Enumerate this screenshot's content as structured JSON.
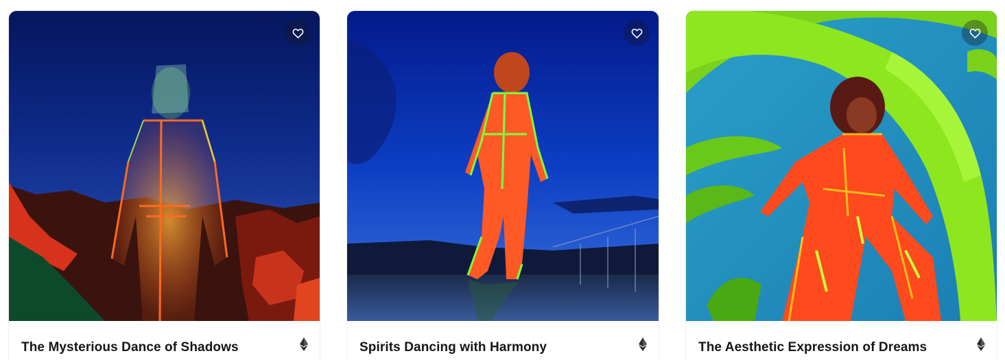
{
  "colors": {
    "text": "#161616",
    "favorite_bg": "rgba(20,24,40,0.35)",
    "card_border": "#ececec"
  },
  "cards": [
    {
      "title": "The Mysterious Dance of Shadows",
      "favorite_icon": "heart-outline-icon",
      "chain_icon": "ethereum-icon"
    },
    {
      "title": "Spirits Dancing with Harmony",
      "favorite_icon": "heart-outline-icon",
      "chain_icon": "ethereum-icon"
    },
    {
      "title": "The Aesthetic Expression of Dreams",
      "favorite_icon": "heart-outline-icon",
      "chain_icon": "ethereum-icon"
    }
  ]
}
